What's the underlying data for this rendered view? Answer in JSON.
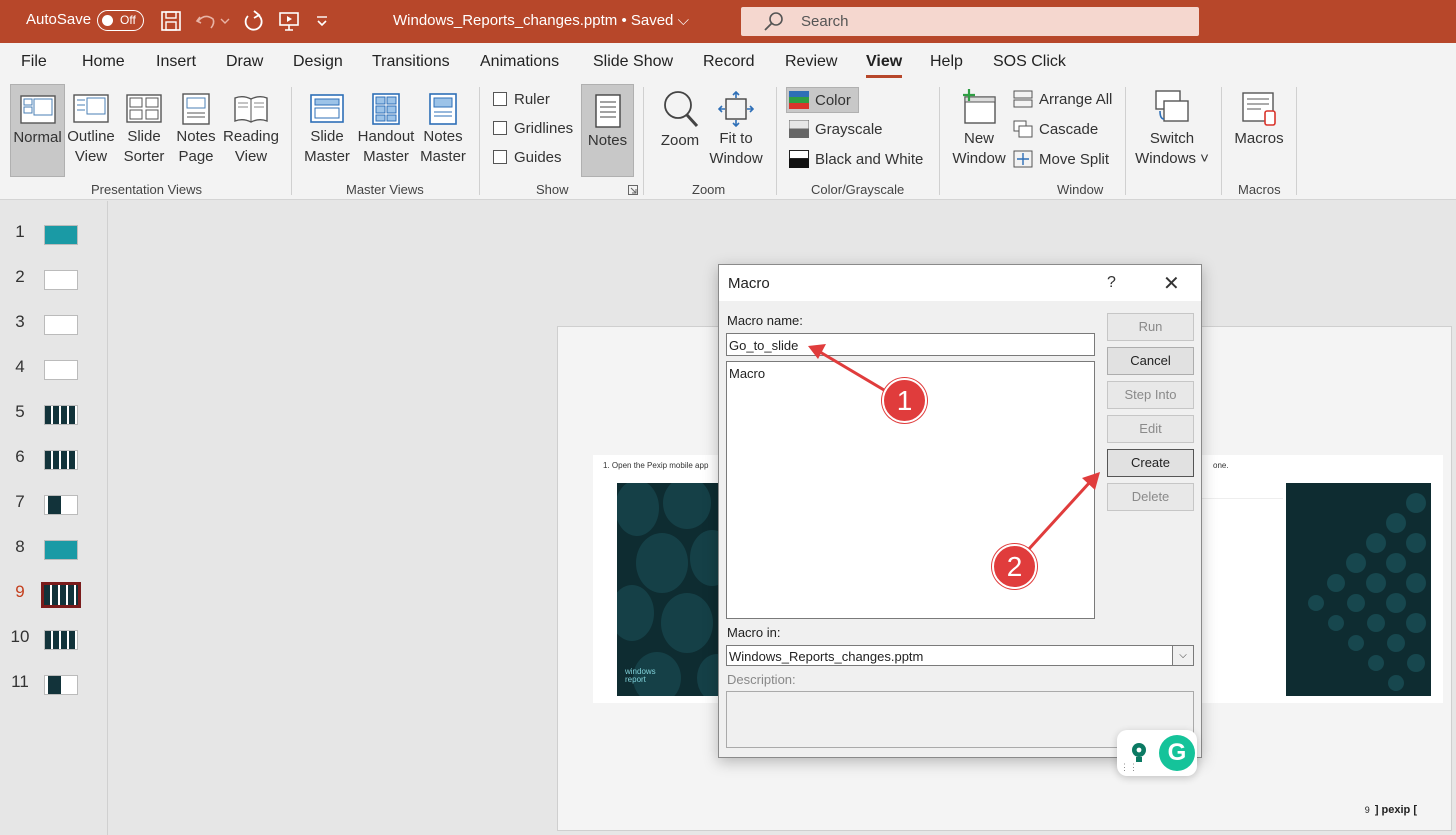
{
  "titlebar": {
    "autosave_label": "AutoSave",
    "autosave_state": "Off",
    "document_title": "Windows_Reports_changes.pptm • Saved ⌵",
    "search_placeholder": "Search"
  },
  "tabs": [
    {
      "label": "File"
    },
    {
      "label": "Home"
    },
    {
      "label": "Insert"
    },
    {
      "label": "Draw"
    },
    {
      "label": "Design"
    },
    {
      "label": "Transitions"
    },
    {
      "label": "Animations"
    },
    {
      "label": "Slide Show"
    },
    {
      "label": "Record"
    },
    {
      "label": "Review"
    },
    {
      "label": "View"
    },
    {
      "label": "Help"
    },
    {
      "label": "SOS Click"
    }
  ],
  "active_tab": "View",
  "ribbon": {
    "presentation_views": {
      "group_label": "Presentation Views",
      "normal": "Normal",
      "outline": [
        "Outline",
        "View"
      ],
      "sorter": [
        "Slide",
        "Sorter"
      ],
      "notes_page": [
        "Notes",
        "Page"
      ],
      "reading": [
        "Reading",
        "View"
      ]
    },
    "master_views": {
      "group_label": "Master Views",
      "slide": [
        "Slide",
        "Master"
      ],
      "handout": [
        "Handout",
        "Master"
      ],
      "notes": [
        "Notes",
        "Master"
      ]
    },
    "show": {
      "group_label": "Show",
      "ruler": "Ruler",
      "gridlines": "Gridlines",
      "guides": "Guides",
      "notes": "Notes"
    },
    "zoom": {
      "group_label": "Zoom",
      "zoom": "Zoom",
      "fit": [
        "Fit to",
        "Window"
      ]
    },
    "color": {
      "group_label": "Color/Grayscale",
      "color": "Color",
      "grayscale": "Grayscale",
      "bw": "Black and White"
    },
    "window": {
      "group_label": "Window",
      "new_window": [
        "New",
        "Window"
      ],
      "arrange_all": "Arrange All",
      "cascade": "Cascade",
      "move_split": "Move Split",
      "switch": [
        "Switch",
        "Windows ˅"
      ]
    },
    "macros": {
      "group_label": "Macros",
      "macros": "Macros"
    }
  },
  "slides": [
    "1",
    "2",
    "3",
    "4",
    "5",
    "6",
    "7",
    "8",
    "9",
    "10",
    "11"
  ],
  "current_slide": "9",
  "slide": {
    "step_text_left": "1.  Open the Pexip mobile app",
    "step_text_right": "one.",
    "logo_text": [
      "windows",
      "report"
    ],
    "page_number": "9",
    "brand": "] pexip ["
  },
  "dialog": {
    "title": "Macro",
    "help": "?",
    "close": "✕",
    "macro_name_label": "Macro name:",
    "macro_name_value": "Go_to_slide",
    "list_items": [
      "Macro"
    ],
    "macro_in_label": "Macro in:",
    "macro_in_value": "Windows_Reports_changes.pptm",
    "description_label": "Description:",
    "buttons": {
      "run": "Run",
      "cancel": "Cancel",
      "step_into": "Step Into",
      "edit": "Edit",
      "create": "Create",
      "delete": "Delete"
    }
  },
  "annotations": {
    "marker1": "1",
    "marker2": "2",
    "color": "#e03c3c"
  },
  "colors": {
    "accent": "#b7472a",
    "grammarly": "#15c39a"
  }
}
